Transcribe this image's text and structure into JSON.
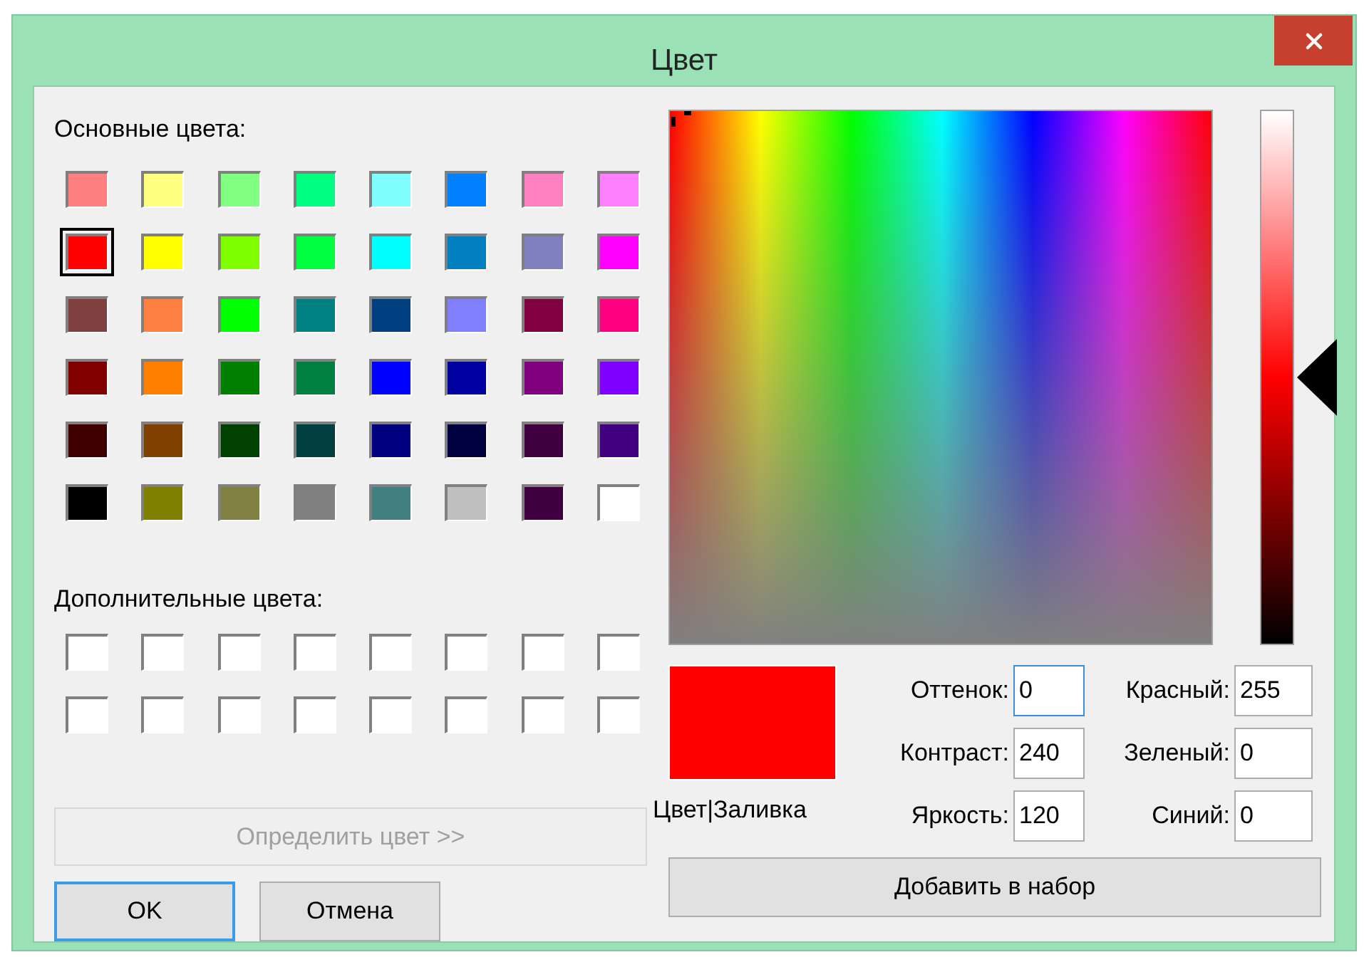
{
  "window": {
    "title": "Цвет"
  },
  "basic_colors": {
    "label": "Основные цвета:",
    "swatches": [
      {
        "color": "#ff8080",
        "selected": false
      },
      {
        "color": "#ffff80",
        "selected": false
      },
      {
        "color": "#80ff80",
        "selected": false
      },
      {
        "color": "#00ff80",
        "selected": false
      },
      {
        "color": "#80ffff",
        "selected": false
      },
      {
        "color": "#0080ff",
        "selected": false
      },
      {
        "color": "#ff80c0",
        "selected": false
      },
      {
        "color": "#ff80ff",
        "selected": false
      },
      {
        "color": "#ff0000",
        "selected": true
      },
      {
        "color": "#ffff00",
        "selected": false
      },
      {
        "color": "#80ff00",
        "selected": false
      },
      {
        "color": "#00ff40",
        "selected": false
      },
      {
        "color": "#00ffff",
        "selected": false
      },
      {
        "color": "#0080c0",
        "selected": false
      },
      {
        "color": "#8080c0",
        "selected": false
      },
      {
        "color": "#ff00ff",
        "selected": false
      },
      {
        "color": "#804040",
        "selected": false
      },
      {
        "color": "#ff8040",
        "selected": false
      },
      {
        "color": "#00ff00",
        "selected": false
      },
      {
        "color": "#008080",
        "selected": false
      },
      {
        "color": "#004080",
        "selected": false
      },
      {
        "color": "#8080ff",
        "selected": false
      },
      {
        "color": "#800040",
        "selected": false
      },
      {
        "color": "#ff0080",
        "selected": false
      },
      {
        "color": "#800000",
        "selected": false
      },
      {
        "color": "#ff8000",
        "selected": false
      },
      {
        "color": "#008000",
        "selected": false
      },
      {
        "color": "#008040",
        "selected": false
      },
      {
        "color": "#0000ff",
        "selected": false
      },
      {
        "color": "#0000a0",
        "selected": false
      },
      {
        "color": "#800080",
        "selected": false
      },
      {
        "color": "#8000ff",
        "selected": false
      },
      {
        "color": "#400000",
        "selected": false
      },
      {
        "color": "#804000",
        "selected": false
      },
      {
        "color": "#004000",
        "selected": false
      },
      {
        "color": "#004040",
        "selected": false
      },
      {
        "color": "#000080",
        "selected": false
      },
      {
        "color": "#000040",
        "selected": false
      },
      {
        "color": "#400040",
        "selected": false
      },
      {
        "color": "#400080",
        "selected": false
      },
      {
        "color": "#000000",
        "selected": false
      },
      {
        "color": "#808000",
        "selected": false
      },
      {
        "color": "#808040",
        "selected": false
      },
      {
        "color": "#808080",
        "selected": false
      },
      {
        "color": "#408080",
        "selected": false
      },
      {
        "color": "#c0c0c0",
        "selected": false
      },
      {
        "color": "#400040",
        "selected": false
      },
      {
        "color": "#ffffff",
        "selected": false
      }
    ]
  },
  "custom_colors": {
    "label": "Дополнительные цвета:",
    "swatches": [
      {
        "color": "#ffffff",
        "selected": false
      },
      {
        "color": "#ffffff",
        "selected": false
      },
      {
        "color": "#ffffff",
        "selected": false
      },
      {
        "color": "#ffffff",
        "selected": false
      },
      {
        "color": "#ffffff",
        "selected": false
      },
      {
        "color": "#ffffff",
        "selected": false
      },
      {
        "color": "#ffffff",
        "selected": false
      },
      {
        "color": "#ffffff",
        "selected": false
      },
      {
        "color": "#ffffff",
        "selected": false
      },
      {
        "color": "#ffffff",
        "selected": false
      },
      {
        "color": "#ffffff",
        "selected": false
      },
      {
        "color": "#ffffff",
        "selected": false
      },
      {
        "color": "#ffffff",
        "selected": false
      },
      {
        "color": "#ffffff",
        "selected": false
      },
      {
        "color": "#ffffff",
        "selected": false
      },
      {
        "color": "#ffffff",
        "selected": false
      }
    ]
  },
  "define_button": {
    "label": "Определить цвет >>",
    "disabled": true
  },
  "buttons": [
    {
      "label": "OK",
      "focused": true
    },
    {
      "label": "Отмена",
      "focused": false
    }
  ],
  "luminance": {
    "level": 0.5
  },
  "preview": {
    "color": "#ff0000",
    "label": "Цвет|Заливка"
  },
  "fields": [
    {
      "label": "Оттенок:",
      "value": "0",
      "focused": true
    },
    {
      "label": "Красный:",
      "value": "255",
      "focused": false
    },
    {
      "label": "Контраст:",
      "value": "240",
      "focused": false
    },
    {
      "label": "Зеленый:",
      "value": "0",
      "focused": false
    },
    {
      "label": "Яркость:",
      "value": "120",
      "focused": false
    },
    {
      "label": "Синий:",
      "value": "0",
      "focused": false
    }
  ],
  "add_button": {
    "label": "Добавить в набор"
  }
}
